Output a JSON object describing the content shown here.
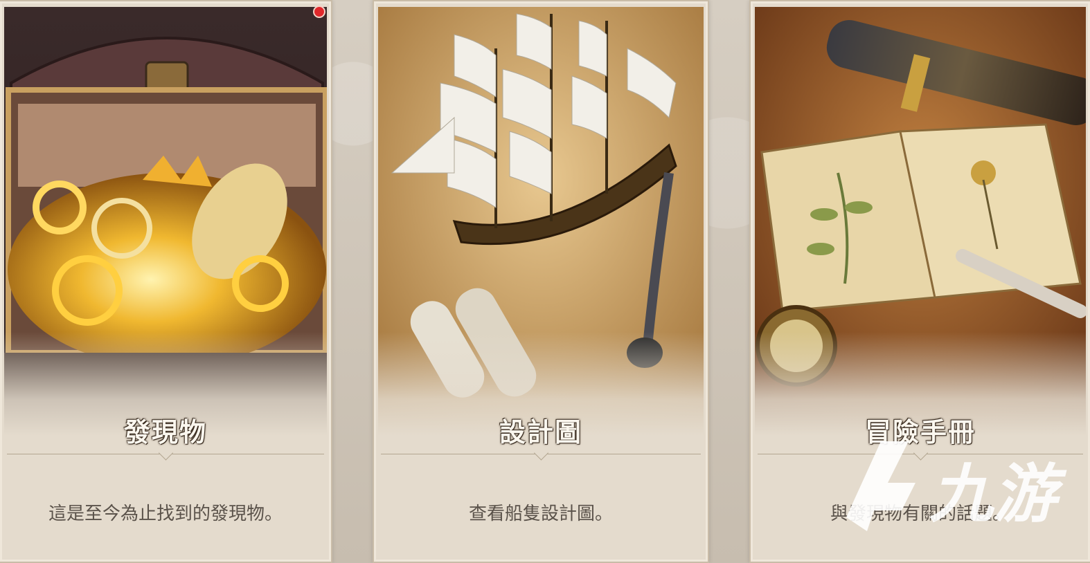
{
  "cards": [
    {
      "title": "發現物",
      "description": "這是至今為止找到的發現物。",
      "has_notification": true
    },
    {
      "title": "設計圖",
      "description": "查看船隻設計圖。"
    },
    {
      "title": "冒險手冊",
      "description": "與發現物有關的話題。"
    }
  ],
  "watermark": {
    "text": "九游"
  },
  "colors": {
    "card_bg": "#e4dbcd",
    "title_text": "#fbf7ef",
    "desc_text": "#5a524a",
    "notification": "#e0282b"
  }
}
